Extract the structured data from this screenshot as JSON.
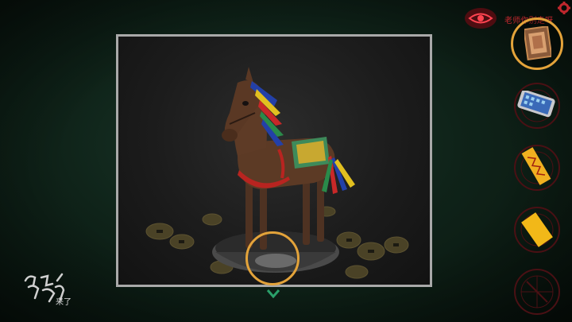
{
  "hud": {
    "top_label": "老师你别走呀",
    "icons": {
      "hint": "eye-icon",
      "settings": "gear-icon",
      "navigate": "chevron-down-icon"
    }
  },
  "scene": {
    "object": "wooden-horse-figurine",
    "highlight": "bowl-contents"
  },
  "inventory": {
    "items": [
      {
        "icon": "framed-picture-item",
        "selected": true
      },
      {
        "icon": "smartphone-item",
        "selected": false
      },
      {
        "icon": "paper-talisman-item",
        "selected": false
      },
      {
        "icon": "yellow-paper-item",
        "selected": false
      },
      {
        "icon": "empty-slot",
        "selected": false
      }
    ]
  },
  "branding": {
    "logo_text": "来了"
  },
  "colors": {
    "accent": "#e3a33a",
    "alert_red": "#c0272d",
    "frame_border": "#a9a9a9"
  }
}
